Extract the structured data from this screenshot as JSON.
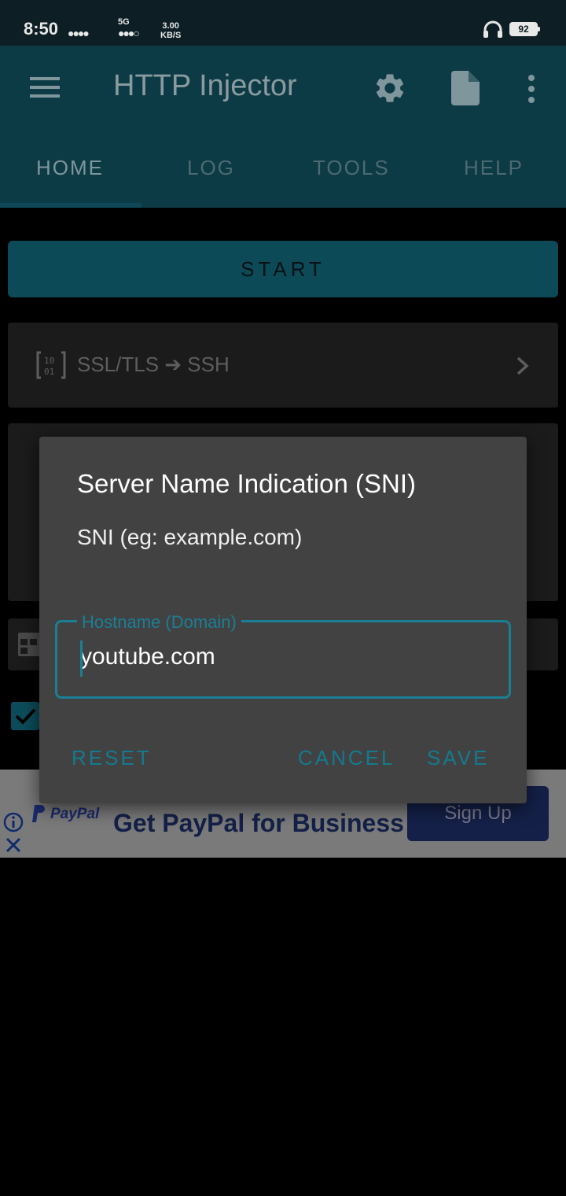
{
  "status_bar": {
    "time": "8:50",
    "network": "5G",
    "speed_value": "3.00",
    "speed_unit": "KB/S",
    "battery": "92"
  },
  "app_bar": {
    "title": "HTTP Injector",
    "icons": [
      "menu-icon",
      "gear-icon",
      "document-icon",
      "more-vert-icon"
    ]
  },
  "tabs": [
    {
      "label": "HOME",
      "active": true
    },
    {
      "label": "LOG",
      "active": false
    },
    {
      "label": "TOOLS",
      "active": false
    },
    {
      "label": "HELP",
      "active": false
    }
  ],
  "main": {
    "start_label": "START",
    "mode_label": "SSL/TLS ➔ SSH"
  },
  "ad": {
    "brand": "PayPal",
    "headline": "Get PayPal for Business",
    "button": "Sign Up"
  },
  "dialog": {
    "title": "Server Name Indication (SNI)",
    "message": "SNI (eg: example.com)",
    "field_label": "Hostname (Domain)",
    "field_value": "youtube.com",
    "reset_label": "RESET",
    "cancel_label": "CANCEL",
    "save_label": "SAVE"
  },
  "colors": {
    "app_bar": "#0c3a45",
    "accent": "#1a7f95",
    "dialog_bg": "#424242"
  }
}
